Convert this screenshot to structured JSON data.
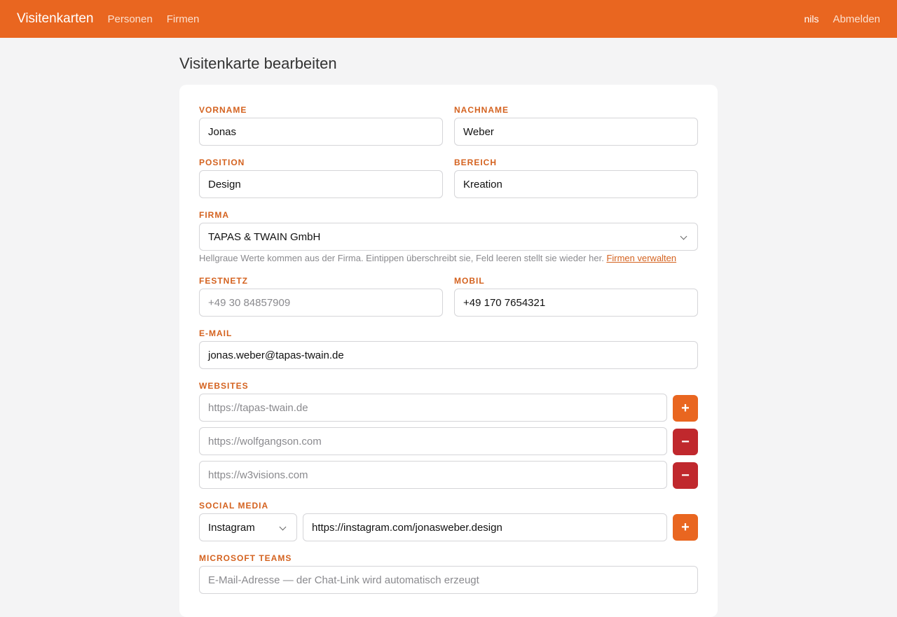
{
  "nav": {
    "brand": "Visitenkarten",
    "links": [
      "Personen",
      "Firmen"
    ],
    "user": "nils",
    "logout": "Abmelden"
  },
  "page": {
    "title": "Visitenkarte bearbeiten"
  },
  "form": {
    "vorname": {
      "label": "Vorname",
      "value": "Jonas"
    },
    "nachname": {
      "label": "Nachname",
      "value": "Weber"
    },
    "position": {
      "label": "Position",
      "value": "Design"
    },
    "bereich": {
      "label": "Bereich",
      "value": "Kreation"
    },
    "firma": {
      "label": "Firma",
      "value": "TAPAS & TWAIN GmbH"
    },
    "firma_help": "Hellgraue Werte kommen aus der Firma. Eintippen überschreibt sie, Feld leeren stellt sie wieder her.",
    "firma_link": "Firmen verwalten",
    "festnetz": {
      "label": "Festnetz",
      "placeholder": "+49 30 84857909"
    },
    "mobil": {
      "label": "Mobil",
      "value": "+49 170 7654321"
    },
    "email": {
      "label": "E-Mail",
      "value": "jonas.weber@tapas-twain.de"
    },
    "websites": {
      "label": "Websites",
      "items": [
        "https://tapas-twain.de",
        "https://wolfgangson.com",
        "https://w3visions.com"
      ],
      "buttons": [
        "+",
        "−",
        "−"
      ]
    },
    "social": {
      "label": "Social Media",
      "network": "Instagram",
      "url": "https://instagram.com/jonasweber.design",
      "add": "+"
    },
    "teams": {
      "label": "Microsoft Teams",
      "placeholder": "E-Mail-Adresse — der Chat-Link wird automatisch erzeugt"
    }
  }
}
